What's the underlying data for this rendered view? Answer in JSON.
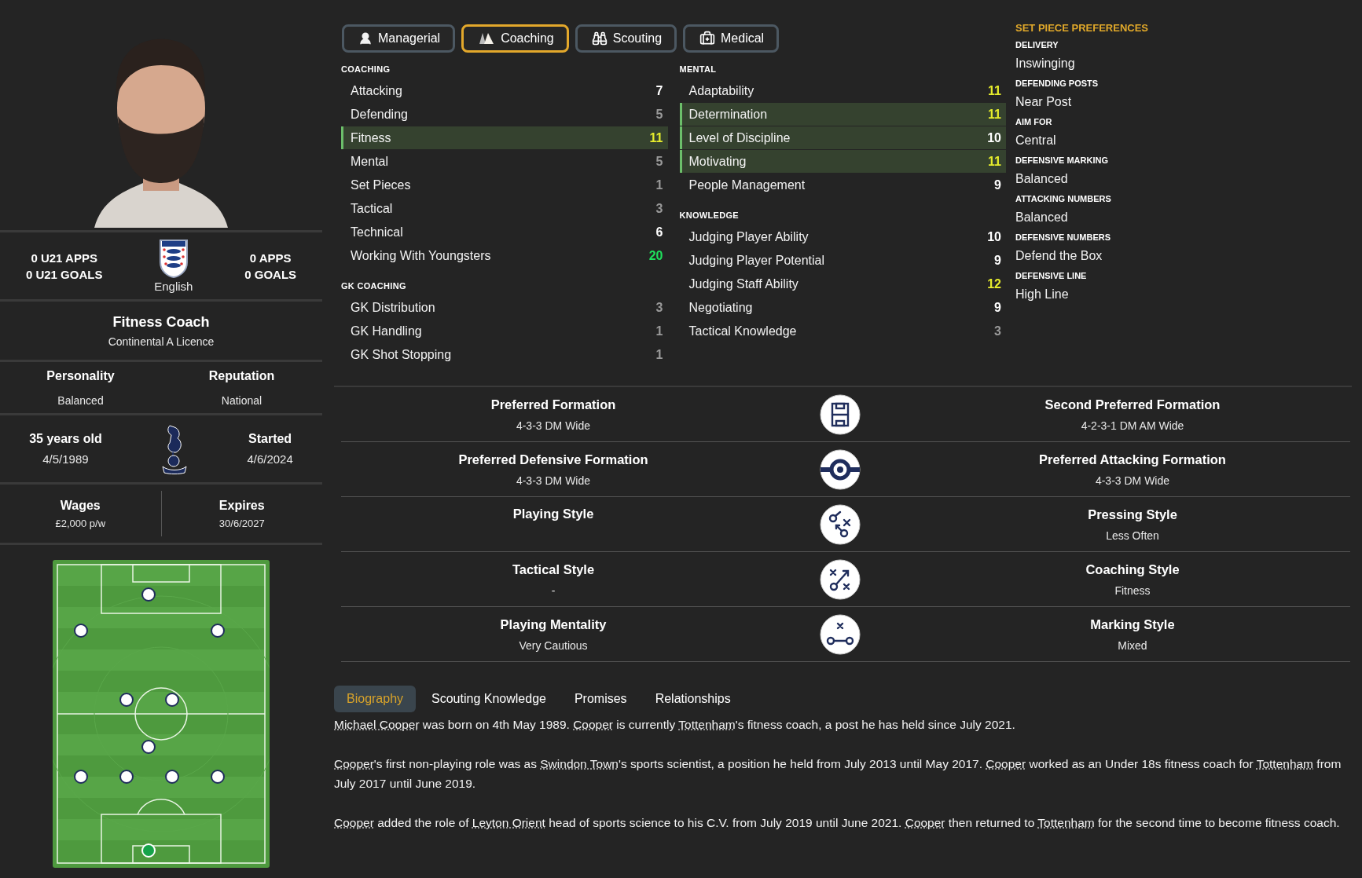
{
  "stats": {
    "left": [
      "0 U21 APPS",
      "0 U21 GOALS"
    ],
    "nationality": "English",
    "right": [
      "0 APPS",
      "0 GOALS"
    ]
  },
  "job": {
    "title": "Fitness Coach",
    "licence": "Continental A Licence"
  },
  "info": [
    {
      "label": "Personality",
      "value": "Balanced"
    },
    {
      "label": "Reputation",
      "value": "National"
    }
  ],
  "age": {
    "label": "35 years old",
    "value": "4/5/1989"
  },
  "started": {
    "label": "Started",
    "value": "4/6/2024"
  },
  "contract": [
    {
      "label": "Wages",
      "value": "£2,000 p/w"
    },
    {
      "label": "Expires",
      "value": "30/6/2027"
    }
  ],
  "tabs": [
    {
      "label": "Managerial",
      "kind": "managerial",
      "selected": false
    },
    {
      "label": "Coaching",
      "kind": "coaching",
      "selected": true
    },
    {
      "label": "Scouting",
      "kind": "scouting",
      "selected": false
    },
    {
      "label": "Medical",
      "kind": "medical",
      "selected": false
    }
  ],
  "attribute_columns": [
    [
      {
        "title": "COACHING",
        "attributes": [
          {
            "name": "Attacking",
            "value": "7",
            "color": "#ffffff",
            "highlighted": false
          },
          {
            "name": "Defending",
            "value": "5",
            "color": "#9a9a9a",
            "highlighted": false
          },
          {
            "name": "Fitness",
            "value": "11",
            "color": "#e6ec2c",
            "highlighted": true
          },
          {
            "name": "Mental",
            "value": "5",
            "color": "#9a9a9a",
            "highlighted": false
          },
          {
            "name": "Set Pieces",
            "value": "1",
            "color": "#9a9a9a",
            "highlighted": false
          },
          {
            "name": "Tactical",
            "value": "3",
            "color": "#9a9a9a",
            "highlighted": false
          },
          {
            "name": "Technical",
            "value": "6",
            "color": "#ffffff",
            "highlighted": false
          },
          {
            "name": "Working With Youngsters",
            "value": "20",
            "color": "#1fe05c",
            "highlighted": false
          }
        ]
      },
      {
        "title": "GK COACHING",
        "attributes": [
          {
            "name": "GK Distribution",
            "value": "3",
            "color": "#9a9a9a",
            "highlighted": false
          },
          {
            "name": "GK Handling",
            "value": "1",
            "color": "#9a9a9a",
            "highlighted": false
          },
          {
            "name": "GK Shot Stopping",
            "value": "1",
            "color": "#9a9a9a",
            "highlighted": false
          }
        ]
      }
    ],
    [
      {
        "title": "MENTAL",
        "attributes": [
          {
            "name": "Adaptability",
            "value": "11",
            "color": "#e6ec2c",
            "highlighted": false
          },
          {
            "name": "Determination",
            "value": "11",
            "color": "#e6ec2c",
            "highlighted": true
          },
          {
            "name": "Level of Discipline",
            "value": "10",
            "color": "#ffffff",
            "highlighted": true
          },
          {
            "name": "Motivating",
            "value": "11",
            "color": "#e6ec2c",
            "highlighted": true
          },
          {
            "name": "People Management",
            "value": "9",
            "color": "#ffffff",
            "highlighted": false
          }
        ]
      },
      {
        "title": "KNOWLEDGE",
        "attributes": [
          {
            "name": "Judging Player Ability",
            "value": "10",
            "color": "#ffffff",
            "highlighted": false
          },
          {
            "name": "Judging Player Potential",
            "value": "9",
            "color": "#ffffff",
            "highlighted": false
          },
          {
            "name": "Judging Staff Ability",
            "value": "12",
            "color": "#e6ec2c",
            "highlighted": false
          },
          {
            "name": "Negotiating",
            "value": "9",
            "color": "#ffffff",
            "highlighted": false
          },
          {
            "name": "Tactical Knowledge",
            "value": "3",
            "color": "#9a9a9a",
            "highlighted": false
          }
        ]
      }
    ]
  ],
  "set_piece_preferences": {
    "title": "SET PIECE PREFERENCES",
    "items": [
      {
        "label": "DELIVERY",
        "value": "Inswinging"
      },
      {
        "label": "DEFENDING POSTS",
        "value": "Near Post"
      },
      {
        "label": "AIM FOR",
        "value": "Central"
      },
      {
        "label": "DEFENSIVE MARKING",
        "value": "Balanced"
      },
      {
        "label": "ATTACKING NUMBERS",
        "value": "Balanced"
      },
      {
        "label": "DEFENSIVE NUMBERS",
        "value": "Defend the Box"
      },
      {
        "label": "DEFENSIVE LINE",
        "value": "High Line"
      }
    ]
  },
  "tactics": [
    {
      "kind": "pitch",
      "left": {
        "label": "Preferred Formation",
        "value": "4-3-3 DM Wide"
      },
      "right": {
        "label": "Second Preferred Formation",
        "value": "4-2-3-1 DM AM Wide"
      }
    },
    {
      "kind": "ring",
      "left": {
        "label": "Preferred Defensive Formation",
        "value": "4-3-3 DM Wide"
      },
      "right": {
        "label": "Preferred Attacking Formation",
        "value": "4-3-3 DM Wide"
      }
    },
    {
      "kind": "moves",
      "left": {
        "label": "Playing Style"
      },
      "right": {
        "label": "Pressing Style",
        "value": "Less Often"
      }
    },
    {
      "kind": "arrow",
      "left": {
        "label": "Tactical Style",
        "value": "-"
      },
      "right": {
        "label": "Coaching Style",
        "value": "Fitness"
      }
    },
    {
      "kind": "link",
      "left": {
        "label": "Playing Mentality",
        "value": "Very Cautious"
      },
      "right": {
        "label": "Marking Style",
        "value": "Mixed"
      }
    }
  ],
  "bio_tabs": [
    {
      "label": "Biography",
      "selected": true
    },
    {
      "label": "Scouting Knowledge",
      "selected": false
    },
    {
      "label": "Promises",
      "selected": false
    },
    {
      "label": "Relationships",
      "selected": false
    }
  ],
  "biography": [
    [
      {
        "text": "Michael Cooper",
        "link": true
      },
      {
        "text": " was born on 4th May 1989. ",
        "link": false
      },
      {
        "text": "Cooper",
        "link": true
      },
      {
        "text": " is currently ",
        "link": false
      },
      {
        "text": "Tottenham",
        "link": true
      },
      {
        "text": "'s fitness coach, a post he has held since July 2021.",
        "link": false
      }
    ],
    [
      {
        "text": "Cooper",
        "link": true
      },
      {
        "text": "'s first non-playing role was as ",
        "link": false
      },
      {
        "text": "Swindon Town",
        "link": true
      },
      {
        "text": "'s sports scientist, a position he held from July 2013 until May 2017. ",
        "link": false
      },
      {
        "text": "Cooper",
        "link": true
      },
      {
        "text": " worked as an Under 18s fitness coach for ",
        "link": false
      },
      {
        "text": "Tottenham",
        "link": true
      },
      {
        "text": " from July 2017 until June 2019.",
        "link": false
      }
    ],
    [
      {
        "text": "Cooper",
        "link": true
      },
      {
        "text": " added the role of ",
        "link": false
      },
      {
        "text": "Leyton Orient",
        "link": true
      },
      {
        "text": " head of sports science to his C.V. from July 2019 until June 2021. ",
        "link": false
      },
      {
        "text": "Cooper",
        "link": true
      },
      {
        "text": " then returned to ",
        "link": false
      },
      {
        "text": "Tottenham",
        "link": true
      },
      {
        "text": " for the second time to become fitness coach.",
        "link": false
      }
    ]
  ]
}
